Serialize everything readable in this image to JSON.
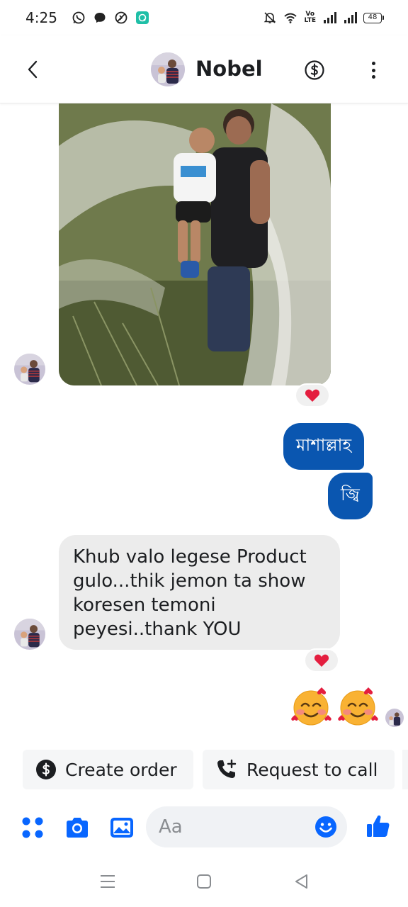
{
  "status_bar": {
    "time": "4:25",
    "network_label_top": "Vo",
    "network_label_bottom": "LTE",
    "battery": "48"
  },
  "header": {
    "contact_name": "Nobel"
  },
  "messages": {
    "outgoing_1": "মাশাল্লাহ",
    "outgoing_2": "জ্বি",
    "incoming_text": "Khub valo legese Product gulo...thik jemon ta show koresen temoni peyesi..thank YOU",
    "reaction_icon": "heart-icon"
  },
  "quick_actions": {
    "create_order": "Create order",
    "request_call": "Request to call"
  },
  "composer": {
    "placeholder": "Aa"
  },
  "colors": {
    "accent": "#0a56b0",
    "icon_blue": "#0866ff",
    "reaction_red": "#e41e3f",
    "incoming_bubble": "#ececec"
  }
}
